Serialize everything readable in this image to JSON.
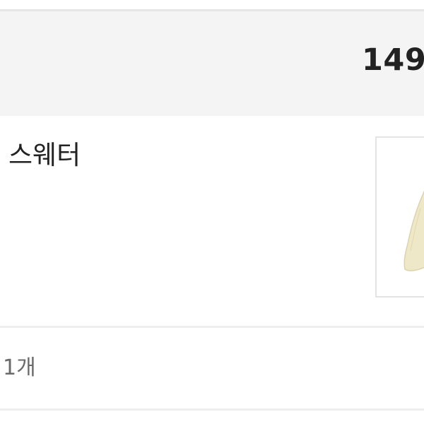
{
  "summary": {
    "total_price": "149"
  },
  "item": {
    "name": "스웨터",
    "thumbnail_icon": "sweater-image",
    "thumbnail_color": "#efe8c8",
    "quantity": "1개"
  }
}
